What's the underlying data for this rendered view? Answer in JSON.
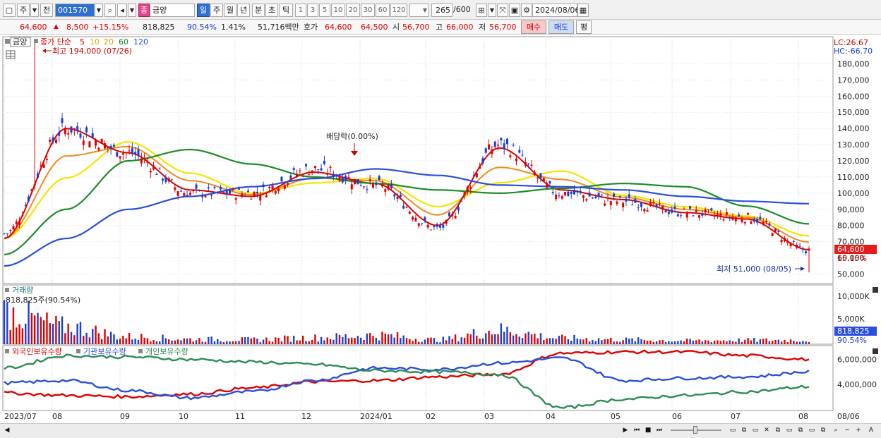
{
  "toolbar": {
    "period_main": "주",
    "prev_label": "전",
    "stock_code": "001570",
    "stock_name": "금양",
    "stock_type_badge": "종",
    "period_tabs": [
      "일",
      "주",
      "월",
      "년",
      "분",
      "초",
      "틱"
    ],
    "period_active": "일",
    "interval_options": [
      "1",
      "3",
      "5",
      "10",
      "20",
      "30",
      "60",
      "120"
    ],
    "range_count": "265",
    "range_total": "/600",
    "date": "2024/08/06"
  },
  "quote": {
    "price": "64,600",
    "change_arrow": "▲",
    "change": "8,500",
    "change_pct": "+15.15%",
    "volume": "818,825",
    "volume_pct": "90.54%",
    "turnover_pct": "1.41%",
    "amount": "51,716백만",
    "hoga_label": "호가",
    "ask": "64,600",
    "bid": "64,500",
    "open_label": "시",
    "open": "56,700",
    "high_label": "고",
    "high": "66,000",
    "low_label": "저",
    "low": "56,700",
    "buy_button": "매수",
    "sell_button": "매도",
    "eval_button": "평"
  },
  "price_panel": {
    "stock_label": "금양",
    "indicator_label": "종가 단순",
    "ma_periods": [
      "5",
      "10",
      "20",
      "60",
      "120"
    ],
    "ma_colors": [
      "#e00000",
      "#f08c1e",
      "#f2e600",
      "#1e8c28",
      "#2a4fe0"
    ],
    "high_annotation": "최고 194,000 (07/26)",
    "low_annotation": "최저 51,000 (08/05)",
    "dividend_annotation": "배당락(0.00%)",
    "lc_label": "LC:26.67",
    "hc_label": "HC:-66.70",
    "y_ticks": [
      "180,000",
      "170,000",
      "160,000",
      "150,000",
      "140,000",
      "130,000",
      "120,000",
      "110,000",
      "100,000",
      "90,000",
      "80,000",
      "70,000",
      "60,000",
      "50,000"
    ],
    "current_price_tag": "64,600",
    "current_pct_tag": "15.15%"
  },
  "volume_panel": {
    "title": "거래량",
    "info": "818,825주(90.54%)",
    "y_ticks": [
      "10,000K",
      "5,000K"
    ],
    "current_tag": "818,825",
    "current_pct_tag": "90.54%"
  },
  "holdings_panel": {
    "foreign_label": "외국인보유수량",
    "institution_label": "기관보유수량",
    "individual_label": "개인보유수량",
    "y_ticks": [
      "6,000,000",
      "4,000,000"
    ],
    "colors": {
      "foreign": "#e00000",
      "institution": "#2a4fe0",
      "individual": "#2e8b57"
    }
  },
  "x_axis": {
    "labels": [
      "2023/07",
      "08",
      "09",
      "10",
      "11",
      "12",
      "2024/01",
      "02",
      "03",
      "04",
      "05",
      "06",
      "07",
      "08",
      "08/06"
    ]
  },
  "chart_data": {
    "type": "candlestick",
    "x": [
      "2023/07",
      "2023/08",
      "2023/09",
      "2023/10",
      "2023/11",
      "2023/12",
      "2024/01",
      "2024/02",
      "2024/03",
      "2024/04",
      "2024/05",
      "2024/06",
      "2024/07",
      "2024/08"
    ],
    "series": [
      {
        "name": "종가",
        "values": [
          75000,
          140000,
          125000,
          100000,
          100000,
          115000,
          105000,
          78000,
          130000,
          100000,
          95000,
          88000,
          85000,
          64600
        ]
      },
      {
        "name": "5",
        "values": [
          72000,
          140000,
          125000,
          102000,
          98000,
          113000,
          106000,
          80000,
          128000,
          102000,
          96000,
          88000,
          84000,
          65000
        ]
      },
      {
        "name": "60",
        "values": [
          62000,
          90000,
          120000,
          127000,
          118000,
          110000,
          106000,
          102000,
          100000,
          103000,
          106000,
          104000,
          92000,
          81000
        ]
      },
      {
        "name": "120",
        "values": [
          55000,
          72000,
          90000,
          98000,
          104000,
          109000,
          115000,
          111000,
          105000,
          104000,
          102000,
          98000,
          95000,
          93500
        ]
      }
    ],
    "high": 194000,
    "low": 51000,
    "ylim": [
      45000,
      195000
    ],
    "volume": {
      "series": [
        {
          "name": "거래량",
          "values": [
            6500,
            3500,
            1500,
            1000,
            900,
            1300,
            1800,
            900,
            2800,
            1200,
            900,
            700,
            800,
            818.825
          ]
        }
      ],
      "unit": "K",
      "ylim": [
        0,
        11000
      ]
    },
    "holdings": {
      "x": [
        "2023/07",
        "2023/08",
        "2023/09",
        "2023/10",
        "2023/11",
        "2023/12",
        "2024/01",
        "2024/02",
        "2024/03",
        "2024/04",
        "2024/05",
        "2024/06",
        "2024/07",
        "2024/08"
      ],
      "series": [
        {
          "name": "외국인보유수량",
          "values": [
            3300000,
            3100000,
            3000000,
            3200000,
            3700000,
            4200000,
            4300000,
            4600000,
            4800000,
            6500000,
            6600000,
            6600000,
            6300000,
            6000000
          ]
        },
        {
          "name": "기관보유수량",
          "values": [
            4100000,
            4300000,
            3500000,
            2900000,
            3400000,
            4300000,
            5300000,
            5200000,
            5700000,
            6100000,
            4300000,
            4500000,
            4600000,
            5000000
          ]
        },
        {
          "name": "개인보유수량",
          "values": [
            5300000,
            6300000,
            6200000,
            6000000,
            5800000,
            5600000,
            5100000,
            5000000,
            4800000,
            2100000,
            2800000,
            3100000,
            3400000,
            3800000
          ]
        }
      ],
      "ylim": [
        2000000,
        7000000
      ]
    }
  }
}
